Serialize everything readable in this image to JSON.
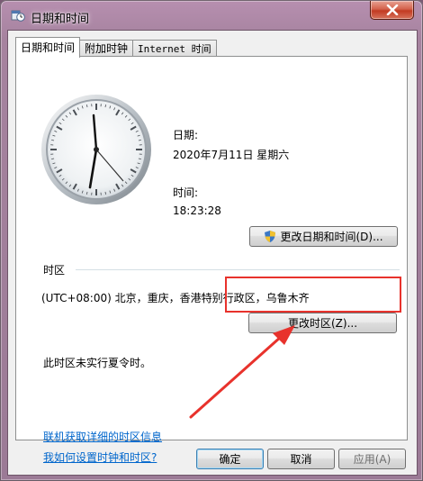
{
  "window": {
    "title": "日期和时间",
    "close_label": "×"
  },
  "tabs": [
    {
      "label": "日期和时间",
      "active": true
    },
    {
      "label": "附加时钟",
      "active": false
    },
    {
      "label": "Internet 时间",
      "active": false
    }
  ],
  "date_section": {
    "date_label": "日期:",
    "date_value": "2020年7月11日 星期六",
    "time_label": "时间:",
    "time_value": "18:23:28",
    "change_datetime_button": "更改日期和时间(D)..."
  },
  "timezone_section": {
    "heading": "时区",
    "current_timezone": "(UTC+08:00) 北京，重庆，香港特别行政区，乌鲁木齐",
    "change_timezone_button": "更改时区(Z)...",
    "dst_note": "此时区未实行夏令时。"
  },
  "links": {
    "online_info": "联机获取详细的时区信息",
    "how_to_set": "我如何设置时钟和时区?"
  },
  "footer": {
    "ok_button": "确定",
    "cancel_button": "取消",
    "apply_button": "应用(A)"
  },
  "colors": {
    "annotation_red": "#e8322c",
    "link_blue": "#0066cc"
  }
}
